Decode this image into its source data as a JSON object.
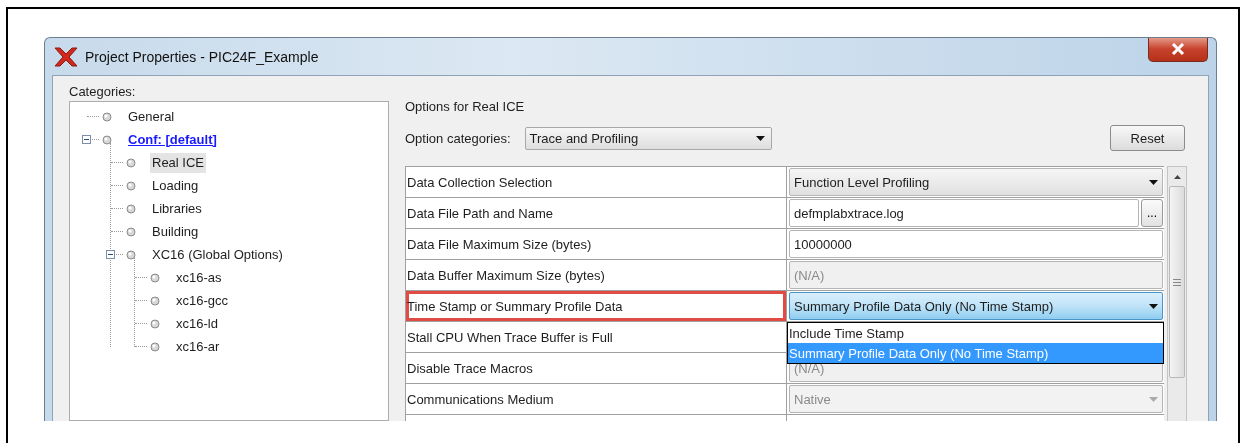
{
  "window": {
    "title": "Project Properties - PIC24F_Example"
  },
  "categories": {
    "label": "Categories:",
    "tree": [
      {
        "label": "General",
        "kind": "node",
        "selected": false
      },
      {
        "label": "Conf: [default]",
        "kind": "link",
        "selected": false,
        "expanded": true,
        "children": [
          {
            "label": "Real ICE",
            "kind": "node",
            "selected": true
          },
          {
            "label": "Loading",
            "kind": "node",
            "selected": false
          },
          {
            "label": "Libraries",
            "kind": "node",
            "selected": false
          },
          {
            "label": "Building",
            "kind": "node",
            "selected": false
          },
          {
            "label": "XC16 (Global Options)",
            "kind": "node",
            "selected": false,
            "expanded": true,
            "children": [
              {
                "label": "xc16-as",
                "kind": "node",
                "selected": false
              },
              {
                "label": "xc16-gcc",
                "kind": "node",
                "selected": false
              },
              {
                "label": "xc16-ld",
                "kind": "node",
                "selected": false
              },
              {
                "label": "xc16-ar",
                "kind": "node",
                "selected": false
              }
            ]
          }
        ]
      }
    ]
  },
  "options": {
    "heading": "Options for Real ICE",
    "category_label": "Option categories:",
    "category_value": "Trace and Profiling",
    "reset_button": "Reset",
    "rows": [
      {
        "label": "Data Collection Selection",
        "kind": "combo",
        "value": "Function Level Profiling",
        "disabled": false,
        "highlighted": false
      },
      {
        "label": "Data File Path and Name",
        "kind": "browse",
        "value": "defmplabxtrace.log",
        "button": "...",
        "disabled": false,
        "highlighted": false
      },
      {
        "label": "Data File Maximum Size (bytes)",
        "kind": "text",
        "value": "10000000",
        "disabled": false,
        "highlighted": false
      },
      {
        "label": "Data Buffer Maximum Size (bytes)",
        "kind": "text",
        "value": "(N/A)",
        "disabled": true,
        "highlighted": false
      },
      {
        "label": "Time Stamp or Summary Profile Data",
        "kind": "combo",
        "value": "Summary Profile Data Only (No Time Stamp)",
        "disabled": false,
        "highlighted": true,
        "open": true,
        "options": [
          {
            "label": "Include Time Stamp",
            "selected": false
          },
          {
            "label": "Summary Profile Data Only (No Time Stamp)",
            "selected": true
          }
        ]
      },
      {
        "label": "Stall CPU When Trace Buffer is Full",
        "kind": "hidden",
        "highlighted": false
      },
      {
        "label": "Disable Trace Macros",
        "kind": "text",
        "value": "(N/A)",
        "disabled": true,
        "highlighted": false
      },
      {
        "label": "Communications Medium",
        "kind": "combo",
        "value": "Native",
        "disabled": true,
        "highlighted": false
      }
    ]
  }
}
